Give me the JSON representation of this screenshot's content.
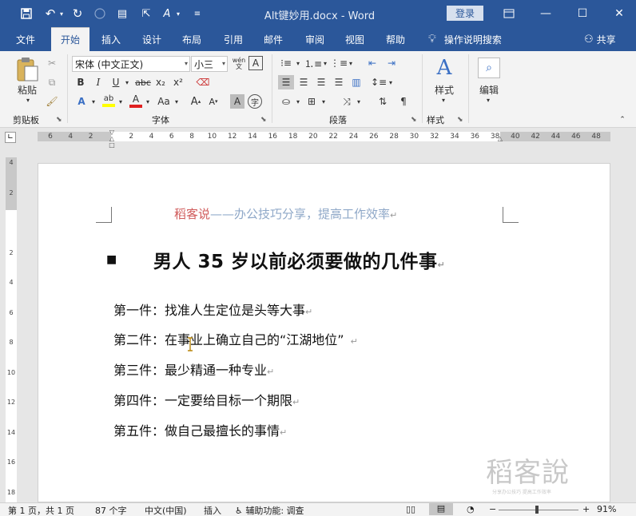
{
  "titlebar": {
    "doc_title": "Alt键妙用.docx  -  Word",
    "login": "登录"
  },
  "tabs": [
    "文件",
    "开始",
    "插入",
    "设计",
    "布局",
    "引用",
    "邮件",
    "审阅",
    "视图",
    "帮助"
  ],
  "active_tab": "开始",
  "tell_me": "操作说明搜索",
  "share": "共享",
  "ribbon": {
    "clipboard_label": "剪贴板",
    "paste_label": "粘贴",
    "font_label": "字体",
    "font_name": "宋体 (中文正文)",
    "font_size": "小三",
    "paragraph_label": "段落",
    "styles_label": "样式",
    "styles_button": "样式",
    "editing_button": "编辑",
    "bold": "B",
    "italic": "I",
    "underline": "U",
    "strike": "abc",
    "subscript": "x₂",
    "superscript": "x²",
    "change_case": "Aa",
    "wen": "wén",
    "char_border": "A"
  },
  "ruler": {
    "h_ticks": [
      "6",
      "4",
      "2",
      "",
      "2",
      "4",
      "6",
      "8",
      "10",
      "12",
      "14",
      "16",
      "18",
      "20",
      "22",
      "24",
      "26",
      "28",
      "30",
      "32",
      "34",
      "36",
      "38",
      "40",
      "42",
      "44",
      "46",
      "48"
    ],
    "v_ticks": [
      "4",
      "2",
      "",
      "2",
      "4",
      "6",
      "8",
      "10",
      "12",
      "14",
      "16",
      "18"
    ]
  },
  "document": {
    "header_a": "稻客说",
    "header_b": "——办公技巧分享，提高工作效率",
    "heading": "男人 35 岁以前必须要做的几件事",
    "items": [
      "第一件：找准人生定位是头等大事",
      "第二件：在事业上确立自己的“江湖地位”",
      "第三件：最少精通一种专业",
      "第四件：一定要给目标一个期限",
      "第五件：做自己最擅长的事情"
    ],
    "logo_text": "稻客說",
    "logo_sub": "分享办公技巧 提高工作效率"
  },
  "status": {
    "page": "第 1 页，共 1 页",
    "words": "87 个字",
    "language": "中文(中国)",
    "mode": "插入",
    "accessibility": "辅助功能: 调查",
    "zoom": "91%"
  },
  "colors": {
    "word_blue": "#2b579a",
    "header_red": "#d05b5b",
    "header_blue": "#8fa8c8"
  }
}
